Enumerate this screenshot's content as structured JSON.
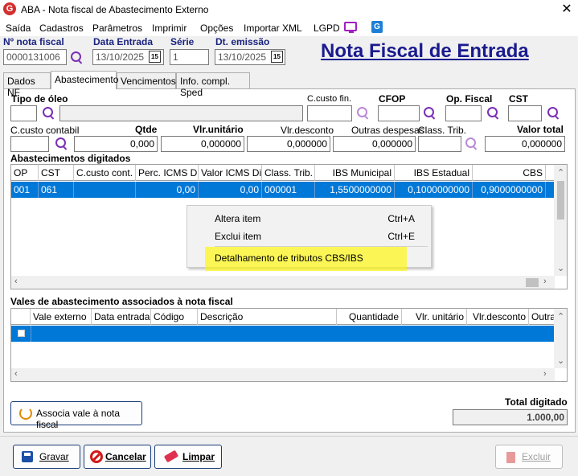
{
  "window": {
    "logo": "G",
    "title": "ABA - Nota fiscal de Abastecimento Externo",
    "close": "✕"
  },
  "menu": [
    "Saída",
    "Cadastros",
    "Parâmetros",
    "Imprimir",
    "Opções",
    "Importar XML",
    "LGPD"
  ],
  "header": {
    "nota_fiscal_label": "Nº nota fiscal",
    "nota_fiscal_value": "0000131006",
    "data_entrada_label": "Data Entrada",
    "data_entrada_value": "13/10/2025",
    "serie_label": "Série",
    "serie_value": "1",
    "dt_emissao_label": "Dt. emissão",
    "dt_emissao_value": "13/10/2025",
    "calendar_glyph": "15",
    "page_title": "Nota Fiscal de Entrada"
  },
  "tabs": [
    "Dados NF",
    "Abastecimento",
    "Vencimentos",
    "Info. compl. Sped"
  ],
  "form": {
    "tipo_oleo_label": "Tipo de óleo",
    "ccusto_fin_label": "C.custo fin.",
    "cfop_label": "CFOP",
    "op_fiscal_label": "Op. Fiscal",
    "cst_label": "CST",
    "ccusto_contabil_label": "C.custo contabil",
    "qtde_label": "Qtde",
    "qtde_value": "0,000",
    "vlr_unitario_label": "Vlr.unitário",
    "vlr_unitario_value": "0,000000",
    "vlr_desconto_label": "Vlr.desconto",
    "vlr_desconto_value": "0,000000",
    "outras_despesas_label": "Outras despesas",
    "outras_despesas_value": "0,000000",
    "class_trib_label": "Class. Trib.",
    "valor_total_label": "Valor total",
    "valor_total_value": "0,000000"
  },
  "abastecimentos": {
    "title": "Abastecimentos digitados",
    "columns": [
      "OP",
      "CST",
      "C.custo cont.",
      "Perc. ICMS Dif.",
      "Valor ICMS Dif.",
      "Class. Trib.",
      "IBS Municipal",
      "IBS Estadual",
      "CBS"
    ],
    "rows": [
      [
        "001",
        "061",
        "",
        "0,00",
        "0,00",
        "000001",
        "1,5500000000",
        "0,1000000000",
        "0,9000000000"
      ]
    ]
  },
  "context_menu": {
    "items": [
      {
        "label": "Altera item",
        "shortcut": "Ctrl+A"
      },
      {
        "label": "Exclui item",
        "shortcut": "Ctrl+E"
      },
      {
        "label": "Detalhamento de tributos CBS/IBS",
        "shortcut": ""
      }
    ]
  },
  "vales": {
    "title": "Vales de abastecimento associados à nota fiscal",
    "columns": [
      "Vale externo",
      "Data entrada",
      "Código",
      "Descrição",
      "Quantidade",
      "Vlr. unitário",
      "Vlr.desconto",
      "Outras"
    ]
  },
  "associa_button": "Associa vale à nota fiscal",
  "total_digitado_label": "Total digitado",
  "total_digitado_value": "1.000,00",
  "buttons": {
    "gravar": "Gravar",
    "cancelar": "Cancelar",
    "limpar": "Limpar",
    "excluir": "Excluir"
  },
  "colors": {
    "selection": "#0078d7",
    "title_blue": "#1a1a8e",
    "highlight": "#fff700"
  }
}
